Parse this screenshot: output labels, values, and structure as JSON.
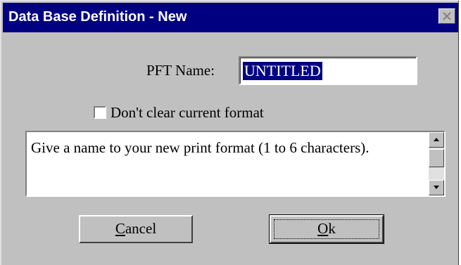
{
  "window": {
    "title": "Data Base Definition - New",
    "close_icon": "close-icon"
  },
  "form": {
    "pft_label": "PFT Name:",
    "pft_value": "UNTITLED",
    "checkbox_label": "Don't clear current format",
    "checkbox_checked": false,
    "help_text": "Give a name to your new print format (1 to 6 characters)."
  },
  "buttons": {
    "cancel_accel": "C",
    "cancel_rest": "ancel",
    "ok_accel": "O",
    "ok_rest": "k"
  },
  "colors": {
    "titlebar": "#000080",
    "face": "#c0c0c0",
    "selection": "#000080"
  }
}
